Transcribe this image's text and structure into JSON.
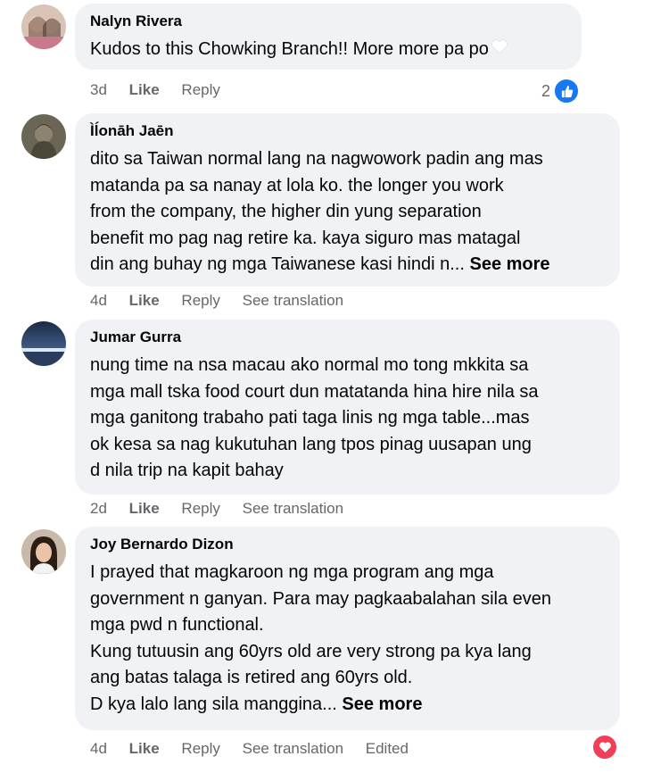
{
  "comments": [
    {
      "author": "Nalyn Rivera",
      "lines": [
        "Kudos to this Chowking Branch!! More more pa po"
      ],
      "see_more": "",
      "time": "3d",
      "like": "Like",
      "reply": "Reply",
      "translate": "",
      "edited": "",
      "reaction_count": "2",
      "reaction_icon": "like-icon",
      "colors": {
        "like_reaction": "#1877f2"
      }
    },
    {
      "author": "Ìĺonāh Jaēn",
      "lines": [
        "dito sa Taiwan normal lang na nagwowork padin ang mas",
        "matanda pa sa nanay at lola ko. the longer you work",
        "from the company, the higher din yung separation",
        "benefit mo pag nag retire ka. kaya siguro mas matagal",
        "din ang buhay ng mga Taiwanese kasi hindi n..."
      ],
      "see_more": "See more",
      "time": "4d",
      "like": "Like",
      "reply": "Reply",
      "translate": "See translation",
      "edited": ""
    },
    {
      "author": "Jumar Gurra",
      "lines": [
        "nung time na nsa macau ako normal mo tong mkkita sa",
        "mga mall tska food court dun matatanda hina hire nila sa",
        "mga ganitong trabaho pati taga linis ng mga table...mas",
        "ok kesa sa nag kukutuhan lang tpos pinag uusapan ung",
        "d nila trip na kapit bahay"
      ],
      "see_more": "",
      "time": "2d",
      "like": "Like",
      "reply": "Reply",
      "translate": "See translation",
      "edited": ""
    },
    {
      "author": "Joy Bernardo Dizon",
      "lines": [
        "I prayed that magkaroon ng mga program ang mga",
        "government n ganyan. Para may pagkaabalahan sila even",
        "mga pwd n functional.",
        "Kung tutuusin ang 60yrs old are very strong pa kya lang",
        "ang batas talaga is retired ang 60yrs old.",
        "D kya lalo lang sila manggina..."
      ],
      "see_more": "See more",
      "time": "4d",
      "like": "Like",
      "reply": "Reply",
      "translate": "See translation",
      "edited": "Edited",
      "reaction_count": "",
      "reaction_icon": "heart-icon",
      "colors": {
        "love_reaction": "#f33e58"
      }
    }
  ]
}
